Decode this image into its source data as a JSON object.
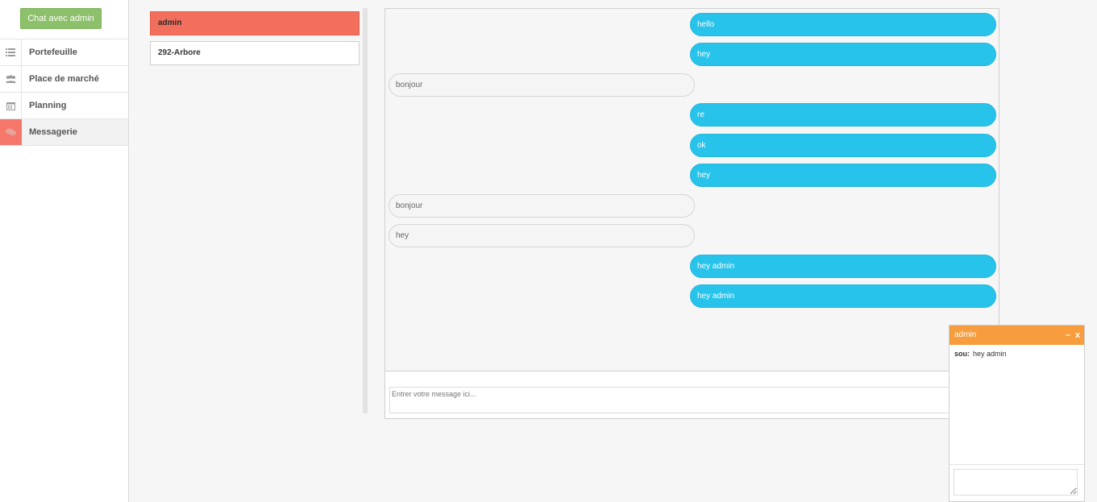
{
  "sidebar": {
    "chat_button": "Chat avec admin",
    "items": [
      {
        "label": "Portefeuille",
        "icon": "list-icon",
        "active": false
      },
      {
        "label": "Place de marché",
        "icon": "users-icon",
        "active": false
      },
      {
        "label": "Planning",
        "icon": "calendar-icon",
        "active": false
      },
      {
        "label": "Messagerie",
        "icon": "chat-bubbles-icon",
        "active": true
      }
    ]
  },
  "contacts": [
    {
      "name": "admin",
      "active": true
    },
    {
      "name": "292-Arbore",
      "active": false
    }
  ],
  "conversation": {
    "messages": [
      {
        "text": "hello",
        "direction": "out"
      },
      {
        "text": "hey",
        "direction": "out"
      },
      {
        "text": "bonjour",
        "direction": "in"
      },
      {
        "text": "re",
        "direction": "out"
      },
      {
        "text": "ok",
        "direction": "out"
      },
      {
        "text": "hey",
        "direction": "out"
      },
      {
        "text": "bonjour",
        "direction": "in"
      },
      {
        "text": "hey",
        "direction": "in"
      },
      {
        "text": "hey admin",
        "direction": "out"
      },
      {
        "text": "hey admin",
        "direction": "out"
      }
    ],
    "composer_placeholder": "Entrer votre message ici..."
  },
  "chatbox": {
    "title": "admin",
    "minimize": "–",
    "close": "x",
    "messages": [
      {
        "sender": "sou:",
        "text": "hey admin"
      }
    ]
  },
  "colors": {
    "accent_red": "#f26f5e",
    "bubble_blue": "#27c3ea",
    "button_green": "#8cc06a",
    "chatbox_orange": "#f79d3d"
  }
}
